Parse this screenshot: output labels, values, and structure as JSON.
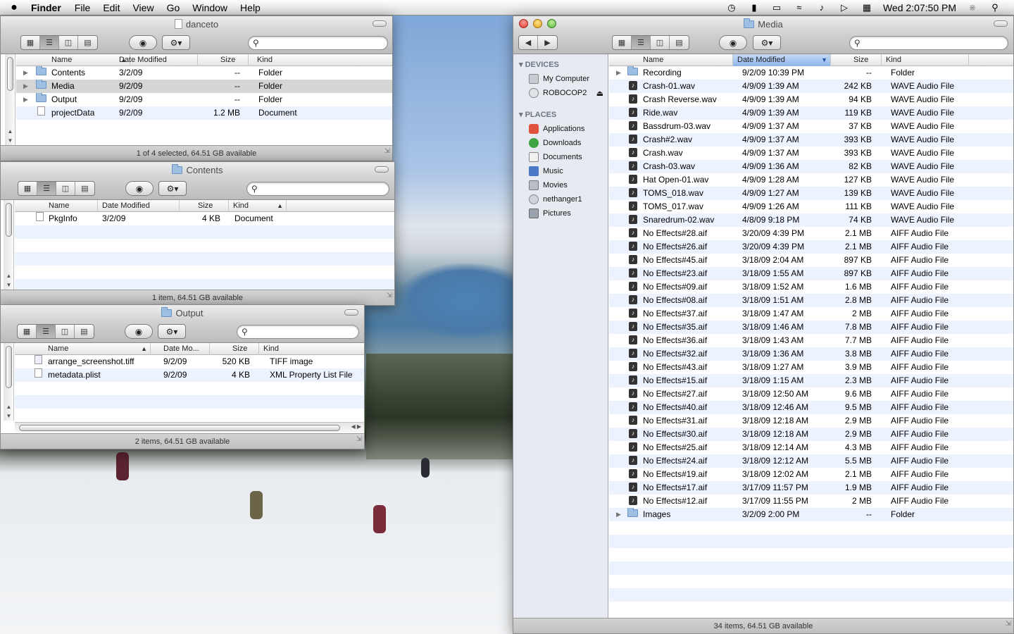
{
  "menubar": {
    "apple": "",
    "app": "Finder",
    "items": [
      "File",
      "Edit",
      "View",
      "Go",
      "Window",
      "Help"
    ],
    "clock": "Wed 2:07:50 PM"
  },
  "win_danceto": {
    "title": "danceto",
    "columns": [
      "Name",
      "Date Modified",
      "Size",
      "Kind"
    ],
    "rows": [
      {
        "name": "Contents",
        "date": "3/2/09",
        "size": "--",
        "kind": "Folder"
      },
      {
        "name": "Media",
        "date": "9/2/09",
        "size": "--",
        "kind": "Folder"
      },
      {
        "name": "Output",
        "date": "9/2/09",
        "size": "--",
        "kind": "Folder"
      },
      {
        "name": "projectData",
        "date": "9/2/09",
        "size": "1.2 MB",
        "kind": "Document"
      }
    ],
    "status": "1 of 4 selected, 64.51 GB available"
  },
  "win_contents": {
    "title": "Contents",
    "columns": [
      "Name",
      "Date Modified",
      "Size",
      "Kind"
    ],
    "rows": [
      {
        "name": "PkgInfo",
        "date": "3/2/09",
        "size": "4 KB",
        "kind": "Document"
      }
    ],
    "status": "1 item, 64.51 GB available"
  },
  "win_output": {
    "title": "Output",
    "columns": [
      "Name",
      "Date Mo...",
      "Size",
      "Kind"
    ],
    "rows": [
      {
        "name": "arrange_screenshot.tiff",
        "date": "9/2/09",
        "size": "520 KB",
        "kind": "TIFF image"
      },
      {
        "name": "metadata.plist",
        "date": "9/2/09",
        "size": "4 KB",
        "kind": "XML Property List File"
      }
    ],
    "status": "2 items, 64.51 GB available"
  },
  "win_media": {
    "title": "Media",
    "columns": [
      "Name",
      "Date Modified",
      "Size",
      "Kind"
    ],
    "sidebar": {
      "devices_label": "DEVICES",
      "devices": [
        "My Computer",
        "ROBOCOP2"
      ],
      "places_label": "PLACES",
      "places": [
        "Applications",
        "Downloads",
        "Documents",
        "Music",
        "Movies",
        "nethanger1",
        "Pictures"
      ]
    },
    "rows": [
      {
        "name": "Recording",
        "date": "9/2/09 10:39 PM",
        "size": "--",
        "kind": "Folder"
      },
      {
        "name": "Crash-01.wav",
        "date": "4/9/09 1:39 AM",
        "size": "242 KB",
        "kind": "WAVE Audio File"
      },
      {
        "name": "Crash Reverse.wav",
        "date": "4/9/09 1:39 AM",
        "size": "94 KB",
        "kind": "WAVE Audio File"
      },
      {
        "name": "Ride.wav",
        "date": "4/9/09 1:39 AM",
        "size": "119 KB",
        "kind": "WAVE Audio File"
      },
      {
        "name": "Bassdrum-03.wav",
        "date": "4/9/09 1:37 AM",
        "size": "37 KB",
        "kind": "WAVE Audio File"
      },
      {
        "name": "Crash#2.wav",
        "date": "4/9/09 1:37 AM",
        "size": "393 KB",
        "kind": "WAVE Audio File"
      },
      {
        "name": "Crash.wav",
        "date": "4/9/09 1:37 AM",
        "size": "393 KB",
        "kind": "WAVE Audio File"
      },
      {
        "name": "Crash-03.wav",
        "date": "4/9/09 1:36 AM",
        "size": "82 KB",
        "kind": "WAVE Audio File"
      },
      {
        "name": "Hat Open-01.wav",
        "date": "4/9/09 1:28 AM",
        "size": "127 KB",
        "kind": "WAVE Audio File"
      },
      {
        "name": "TOMS_018.wav",
        "date": "4/9/09 1:27 AM",
        "size": "139 KB",
        "kind": "WAVE Audio File"
      },
      {
        "name": "TOMS_017.wav",
        "date": "4/9/09 1:26 AM",
        "size": "111 KB",
        "kind": "WAVE Audio File"
      },
      {
        "name": "Snaredrum-02.wav",
        "date": "4/8/09 9:18 PM",
        "size": "74 KB",
        "kind": "WAVE Audio File"
      },
      {
        "name": "No Effects#28.aif",
        "date": "3/20/09 4:39 PM",
        "size": "2.1 MB",
        "kind": "AIFF Audio File"
      },
      {
        "name": "No Effects#26.aif",
        "date": "3/20/09 4:39 PM",
        "size": "2.1 MB",
        "kind": "AIFF Audio File"
      },
      {
        "name": "No Effects#45.aif",
        "date": "3/18/09 2:04 AM",
        "size": "897 KB",
        "kind": "AIFF Audio File"
      },
      {
        "name": "No Effects#23.aif",
        "date": "3/18/09 1:55 AM",
        "size": "897 KB",
        "kind": "AIFF Audio File"
      },
      {
        "name": "No Effects#09.aif",
        "date": "3/18/09 1:52 AM",
        "size": "1.6 MB",
        "kind": "AIFF Audio File"
      },
      {
        "name": "No Effects#08.aif",
        "date": "3/18/09 1:51 AM",
        "size": "2.8 MB",
        "kind": "AIFF Audio File"
      },
      {
        "name": "No Effects#37.aif",
        "date": "3/18/09 1:47 AM",
        "size": "2 MB",
        "kind": "AIFF Audio File"
      },
      {
        "name": "No Effects#35.aif",
        "date": "3/18/09 1:46 AM",
        "size": "7.8 MB",
        "kind": "AIFF Audio File"
      },
      {
        "name": "No Effects#36.aif",
        "date": "3/18/09 1:43 AM",
        "size": "7.7 MB",
        "kind": "AIFF Audio File"
      },
      {
        "name": "No Effects#32.aif",
        "date": "3/18/09 1:36 AM",
        "size": "3.8 MB",
        "kind": "AIFF Audio File"
      },
      {
        "name": "No Effects#43.aif",
        "date": "3/18/09 1:27 AM",
        "size": "3.9 MB",
        "kind": "AIFF Audio File"
      },
      {
        "name": "No Effects#15.aif",
        "date": "3/18/09 1:15 AM",
        "size": "2.3 MB",
        "kind": "AIFF Audio File"
      },
      {
        "name": "No Effects#27.aif",
        "date": "3/18/09 12:50 AM",
        "size": "9.6 MB",
        "kind": "AIFF Audio File"
      },
      {
        "name": "No Effects#40.aif",
        "date": "3/18/09 12:46 AM",
        "size": "9.5 MB",
        "kind": "AIFF Audio File"
      },
      {
        "name": "No Effects#31.aif",
        "date": "3/18/09 12:18 AM",
        "size": "2.9 MB",
        "kind": "AIFF Audio File"
      },
      {
        "name": "No Effects#30.aif",
        "date": "3/18/09 12:18 AM",
        "size": "2.9 MB",
        "kind": "AIFF Audio File"
      },
      {
        "name": "No Effects#25.aif",
        "date": "3/18/09 12:14 AM",
        "size": "4.3 MB",
        "kind": "AIFF Audio File"
      },
      {
        "name": "No Effects#24.aif",
        "date": "3/18/09 12:12 AM",
        "size": "5.5 MB",
        "kind": "AIFF Audio File"
      },
      {
        "name": "No Effects#19.aif",
        "date": "3/18/09 12:02 AM",
        "size": "2.1 MB",
        "kind": "AIFF Audio File"
      },
      {
        "name": "No Effects#17.aif",
        "date": "3/17/09 11:57 PM",
        "size": "1.9 MB",
        "kind": "AIFF Audio File"
      },
      {
        "name": "No Effects#12.aif",
        "date": "3/17/09 11:55 PM",
        "size": "2 MB",
        "kind": "AIFF Audio File"
      },
      {
        "name": "Images",
        "date": "3/2/09 2:00 PM",
        "size": "--",
        "kind": "Folder"
      }
    ],
    "status": "34 items, 64.51 GB available"
  }
}
